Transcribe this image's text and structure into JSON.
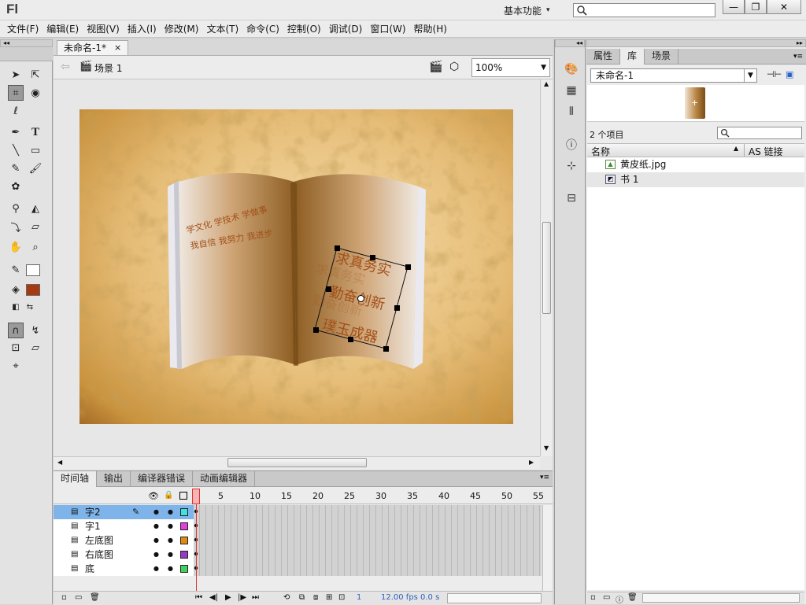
{
  "app": {
    "logo": "Fl",
    "workspace": "基本功能",
    "workspace_arrow": "▾"
  },
  "window_controls": {
    "minimize": "—",
    "restore": "❐",
    "close": "✕"
  },
  "menubar": {
    "items": [
      "文件(F)",
      "编辑(E)",
      "视图(V)",
      "插入(I)",
      "修改(M)",
      "文本(T)",
      "命令(C)",
      "控制(O)",
      "调试(D)",
      "窗口(W)",
      "帮助(H)"
    ]
  },
  "document": {
    "tab_label": "未命名-1*",
    "tab_close": "×",
    "scene_label": "场景 1",
    "zoom": "100%"
  },
  "stage": {
    "left_page_line1": "学文化  学技术  学做事",
    "left_page_line2": "我自信  我努力  我进步",
    "right_page_line1": "求真务实",
    "right_page_line2": "勤奋创新",
    "right_page_line3": "璞玉成器",
    "ghost_line1": "求真务实",
    "ghost_line2": "勤奋创新"
  },
  "timeline": {
    "tabs": [
      "时间轴",
      "输出",
      "编译器错误",
      "动画编辑器"
    ],
    "ruler": [
      "1",
      "5",
      "10",
      "15",
      "20",
      "25",
      "30",
      "35",
      "40",
      "45",
      "50",
      "55"
    ],
    "layers": [
      {
        "name": "字2",
        "color": "#3fe0e0",
        "selected": true
      },
      {
        "name": "字1",
        "color": "#e040e0",
        "selected": false
      },
      {
        "name": "左底图",
        "color": "#e08a10",
        "selected": false
      },
      {
        "name": "右底图",
        "color": "#9a38c8",
        "selected": false
      },
      {
        "name": "底",
        "color": "#40d060",
        "selected": false
      }
    ],
    "status_frame": "1",
    "status_fps": "12.00 fps",
    "status_time": "0.0 s"
  },
  "properties_panel": {
    "tabs": [
      "属性",
      "库",
      "场景"
    ],
    "active_tab": "库",
    "library_name": "未命名-1",
    "item_count": "2 个项目",
    "col_name": "名称",
    "col_link": "AS 链接",
    "items": [
      {
        "name": "黄皮纸.jpg",
        "icon": "bitmap-icon"
      },
      {
        "name": "书 1",
        "icon": "graphic-symbol-icon"
      }
    ]
  },
  "colors": {
    "accent_selected_layer": "#7eb4ea",
    "stroke": "#333333",
    "fill": "#a63a12",
    "playhead": "#e03030"
  }
}
